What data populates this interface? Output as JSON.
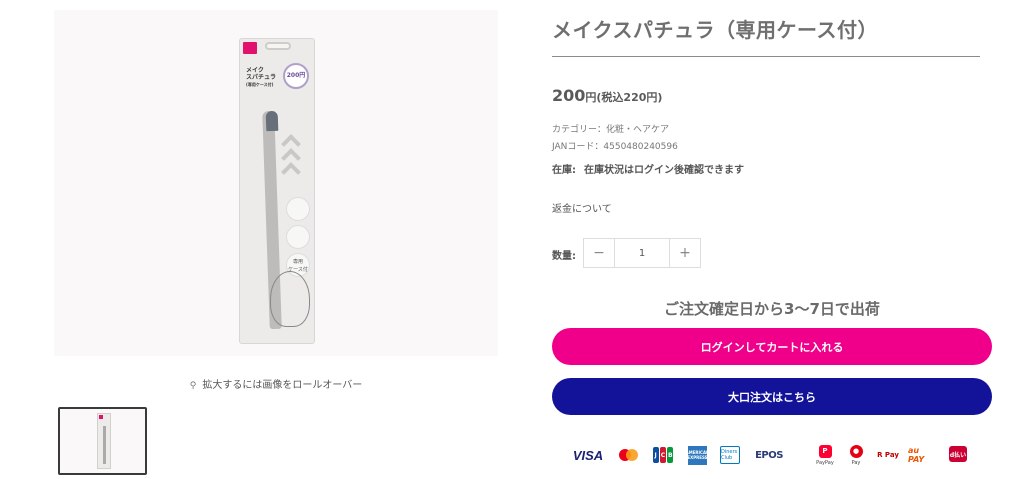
{
  "product": {
    "title": "メイクスパチュラ（専用ケース付）",
    "price": "200",
    "price_suffix": "円(税込220円)",
    "category": "カテゴリー：化粧・ヘアケア",
    "jan": "JANコード：4550480240596",
    "stock_label": "在庫:",
    "stock_text": "在庫状況はログイン後確認できます",
    "refund": "返金について"
  },
  "package_art": {
    "title": "メイク\nスパチュラ",
    "subtitle": "(専用ケース付)",
    "price_badge": "200円",
    "case_badge": "専用\nケース付"
  },
  "gallery": {
    "zoom_hint": "拡大するには画像をロールオーバー",
    "zoom_icon": "search-icon"
  },
  "quantity": {
    "label": "数量:",
    "minus": "−",
    "value": "1",
    "plus": "+"
  },
  "shipping": "ご注文確定日から3〜7日で出荷",
  "buttons": {
    "login_cart": "ログインしてカートに入れる",
    "bulk_order": "大口注文はこちら"
  },
  "payments": {
    "visa": "VISA",
    "jcb": [
      "J",
      "C",
      "B"
    ],
    "amex": "AMERICAN EXPRESS",
    "diners": "Diners Club",
    "epos": "EPOS",
    "paypay": "PayPay",
    "pay": "Pay",
    "rpay": "R Pay",
    "aupay": "au PAY",
    "dpay": "d払い"
  },
  "colors": {
    "login_button": "#f0008a",
    "bulk_button": "#13139a"
  }
}
